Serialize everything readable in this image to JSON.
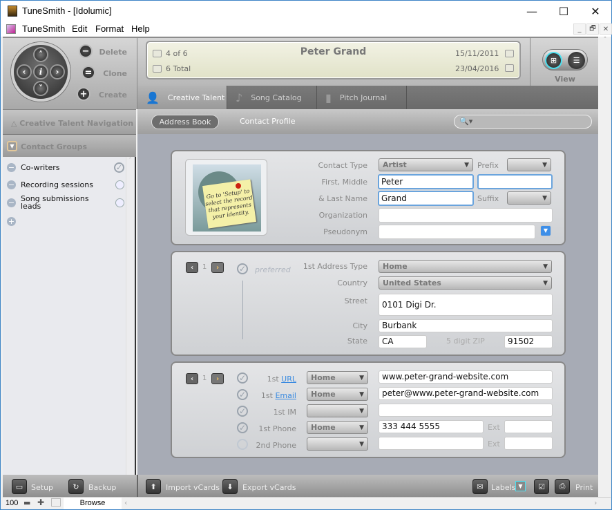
{
  "window": {
    "title": "TuneSmith - [Idolumic]",
    "minimize_icon": "—",
    "maximize_icon": "☐",
    "close_icon": "✕"
  },
  "menu": {
    "items": [
      "TuneSmith",
      "Edit",
      "Format",
      "Help"
    ],
    "mdi": [
      "_",
      "🗗",
      "✕"
    ]
  },
  "toolbar": {
    "dpad": {
      "up": "˄",
      "down": "˅",
      "left": "‹",
      "right": "›",
      "center": "i"
    },
    "delete_label": "Delete",
    "clone_label": "Clone",
    "create_label": "Create",
    "delete_icon": "−",
    "clone_icon": "=",
    "create_icon": "+"
  },
  "record": {
    "position": "4 of 6",
    "total": "6 Total",
    "name": "Peter Grand",
    "created": "15/11/2011",
    "modified": "23/04/2016"
  },
  "view": {
    "label": "View",
    "grid_icon": "⊞",
    "list_icon": "☰"
  },
  "tabs": [
    {
      "label": "Creative Talent",
      "icon": "person-icon",
      "glyph": "👤",
      "active": true
    },
    {
      "label": "Song Catalog",
      "icon": "music-note-icon",
      "glyph": "♪",
      "active": false
    },
    {
      "label": "Pitch Journal",
      "icon": "journal-icon",
      "glyph": "▮",
      "active": false
    }
  ],
  "subnav": {
    "address_book": "Address Book",
    "contact_profile": "Contact Profile",
    "search_icon": "🔍▾"
  },
  "sidebar": {
    "nav_label": "Creative Talent Navigation",
    "groups_label": "Contact Groups",
    "groups": [
      {
        "label": "Co-writers",
        "checked": true
      },
      {
        "label": "Recording sessions",
        "checked": false
      },
      {
        "label": "Song submissions leads",
        "checked": false
      }
    ],
    "add_icon": "+"
  },
  "contact": {
    "photo_note": "Go to 'Setup' to select the record that represents your identity.",
    "labels": {
      "contact_type": "Contact Type",
      "prefix": "Prefix",
      "first_middle": "First, Middle",
      "last_name": "& Last Name",
      "suffix": "Suffix",
      "organization": "Organization",
      "pseudonym": "Pseudonym"
    },
    "contact_type": "Artist",
    "prefix": "",
    "first": "Peter",
    "middle": "",
    "last": "Grand",
    "suffix": "",
    "organization": "",
    "pseudonym": ""
  },
  "address": {
    "index": "1",
    "preferred_label": "preferred",
    "labels": {
      "type": "1st Address Type",
      "country": "Country",
      "street": "Street",
      "city": "City",
      "state": "State",
      "zip": "5 digit ZIP"
    },
    "type": "Home",
    "country": "United States",
    "street": "0101 Digi Dr.",
    "city": "Burbank",
    "state": "CA",
    "zip": "91502"
  },
  "comms": {
    "index": "1",
    "rows": [
      {
        "prefix": "1st",
        "label": "URL",
        "link": true,
        "type": "Home",
        "value": "www.peter-grand-website.com",
        "checked": true
      },
      {
        "prefix": "1st",
        "label": "Email",
        "link": true,
        "type": "Home",
        "value": "peter@www.peter-grand-website.com",
        "checked": true
      },
      {
        "prefix": "1st",
        "label": "IM",
        "link": false,
        "type": "",
        "value": "",
        "checked": true
      },
      {
        "prefix": "1st",
        "label": "Phone",
        "link": false,
        "type": "Home",
        "value": "333 444 5555",
        "ext": "",
        "checked": true
      },
      {
        "prefix": "2nd",
        "label": "Phone",
        "link": false,
        "type": "",
        "value": "",
        "ext": "",
        "checked": false
      }
    ],
    "ext_label": "Ext"
  },
  "bottom": {
    "setup": "Setup",
    "backup": "Backup",
    "import": "Import vCards",
    "export": "Export vCards",
    "labels": "Labels",
    "print": "Print"
  },
  "status": {
    "zoom": "100",
    "mode": "Browse"
  }
}
